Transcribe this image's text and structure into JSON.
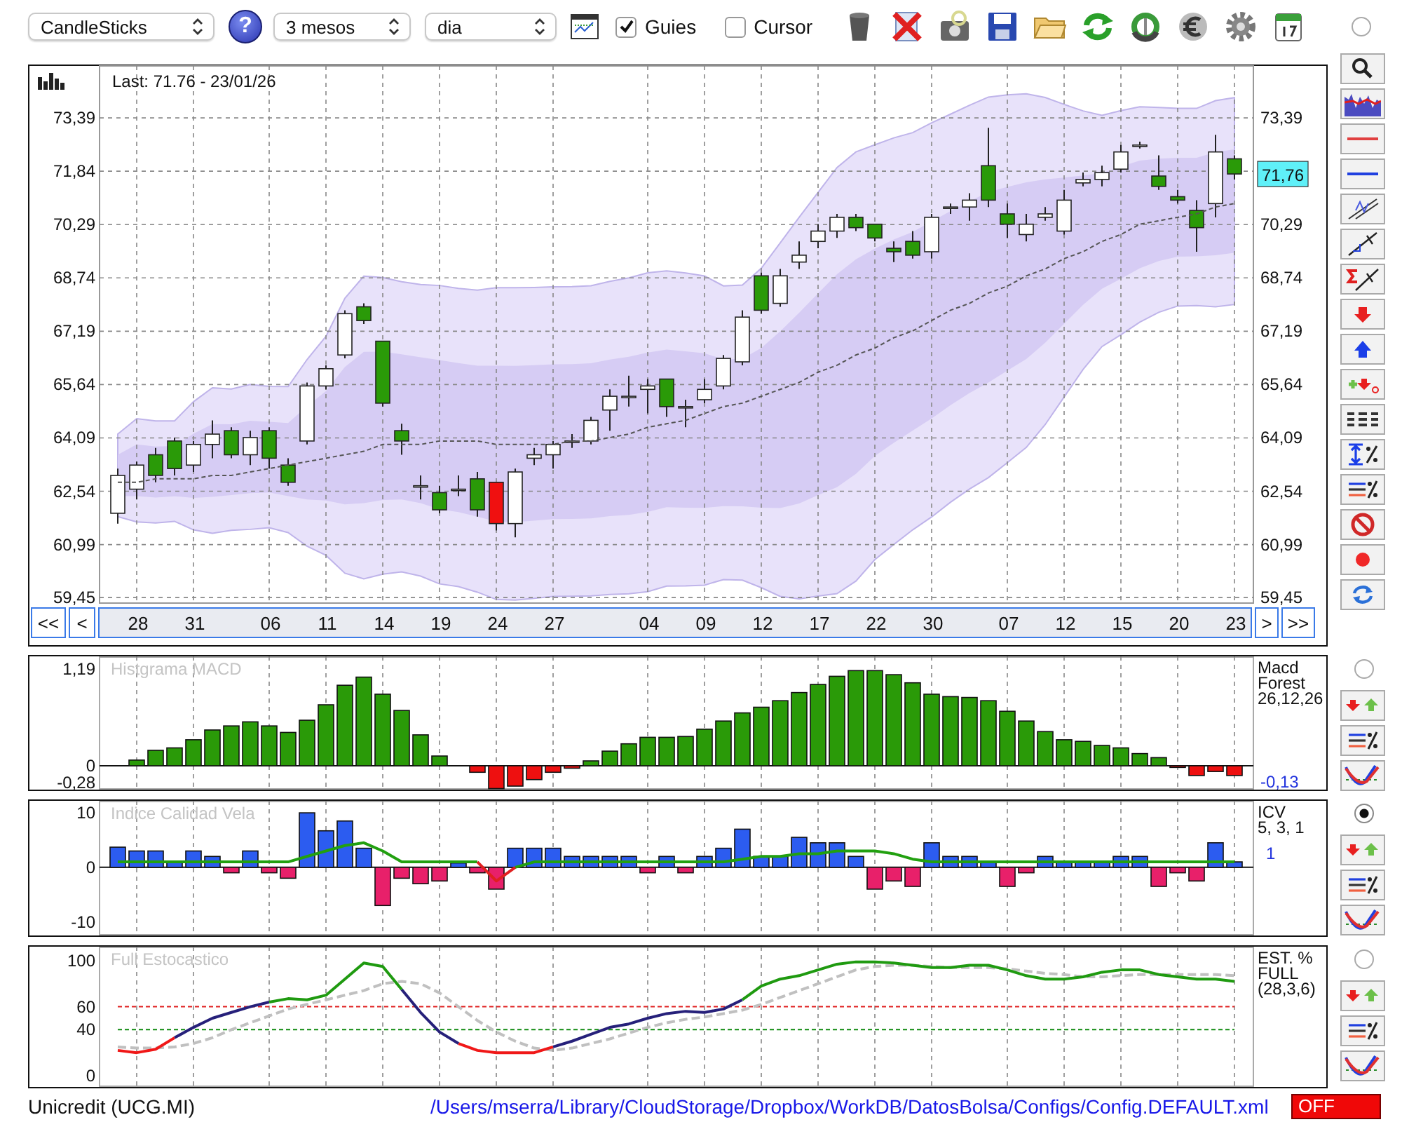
{
  "toolbar": {
    "chart_type": "CandleSticks",
    "help_label": "?",
    "period": "3 mesos",
    "interval": "dia",
    "checkboxes": [
      {
        "label": "Guies",
        "checked": true
      },
      {
        "label": "Cursor",
        "checked": false
      }
    ]
  },
  "price_panel": {
    "selected": false,
    "last": "Last: 71.76 - 23/01/26",
    "current_price": "71,76",
    "nav": {
      "first": "<<",
      "prev": "<",
      "next": ">",
      "last": ">>"
    },
    "right_axis_labels": [
      "73,39",
      "70,29",
      "68,74",
      "67,19",
      "65,64",
      "64,09",
      "62,54",
      "60,99",
      "59,45"
    ],
    "chart_data": {
      "type": "candlestick",
      "grid": true,
      "ylim": [
        59.29,
        74.9
      ],
      "yticks": [
        {
          "value": 73.39,
          "label": "73,39"
        },
        {
          "value": 71.84,
          "label": "71,84"
        },
        {
          "value": 70.29,
          "label": "70,29"
        },
        {
          "value": 68.74,
          "label": "68,74"
        },
        {
          "value": 67.19,
          "label": "67,19"
        },
        {
          "value": 65.64,
          "label": "65,64"
        },
        {
          "value": 64.09,
          "label": "64,09"
        },
        {
          "value": 62.54,
          "label": "62,54"
        },
        {
          "value": 60.99,
          "label": "60,99"
        },
        {
          "value": 59.45,
          "label": "59,45"
        }
      ],
      "categories": [
        null,
        "28",
        null,
        null,
        "31",
        null,
        null,
        null,
        "06",
        null,
        null,
        "11",
        null,
        null,
        "14",
        null,
        null,
        "19",
        null,
        null,
        "24",
        null,
        null,
        "27",
        null,
        null,
        null,
        null,
        "04",
        null,
        null,
        "09",
        null,
        null,
        "12",
        null,
        null,
        "17",
        null,
        null,
        "22",
        null,
        null,
        "30",
        null,
        null,
        null,
        "07",
        null,
        null,
        "12",
        null,
        null,
        "15",
        null,
        null,
        "20",
        null,
        null,
        "23"
      ],
      "ohlc": [
        [
          61.9,
          63.2,
          61.6,
          63.0
        ],
        [
          62.6,
          63.4,
          62.3,
          63.3
        ],
        [
          63.6,
          63.8,
          62.8,
          63.0
        ],
        [
          64.0,
          64.1,
          63.0,
          63.2
        ],
        [
          63.3,
          64.0,
          63.1,
          63.9
        ],
        [
          63.9,
          64.6,
          63.5,
          64.2
        ],
        [
          64.3,
          64.4,
          63.5,
          63.6
        ],
        [
          63.6,
          64.3,
          63.3,
          64.1
        ],
        [
          64.3,
          64.4,
          63.2,
          63.5
        ],
        [
          63.3,
          63.5,
          62.7,
          62.8
        ],
        [
          64.0,
          65.7,
          63.9,
          65.6
        ],
        [
          65.6,
          66.2,
          65.5,
          66.1
        ],
        [
          66.5,
          67.8,
          66.4,
          67.7
        ],
        [
          67.9,
          68.0,
          67.4,
          67.5
        ],
        [
          66.9,
          66.9,
          65.0,
          65.1
        ],
        [
          64.3,
          64.5,
          63.6,
          64.0
        ],
        [
          62.7,
          63.0,
          62.3,
          62.7
        ],
        [
          62.5,
          62.7,
          61.9,
          62.0
        ],
        [
          62.6,
          63.0,
          62.4,
          62.6
        ],
        [
          62.9,
          63.1,
          61.8,
          62.0
        ],
        [
          62.8,
          62.8,
          61.4,
          61.6
        ],
        [
          61.6,
          63.2,
          61.2,
          63.1
        ],
        [
          63.5,
          63.8,
          63.3,
          63.6
        ],
        [
          63.6,
          64.0,
          63.2,
          63.9
        ],
        [
          64.0,
          64.2,
          63.8,
          64.0
        ],
        [
          64.0,
          64.7,
          63.9,
          64.6
        ],
        [
          64.9,
          65.5,
          64.3,
          65.3
        ],
        [
          65.3,
          65.9,
          65.0,
          65.3
        ],
        [
          65.5,
          65.8,
          64.8,
          65.6
        ],
        [
          65.8,
          65.8,
          64.7,
          65.0
        ],
        [
          65.0,
          65.2,
          64.4,
          65.0
        ],
        [
          65.2,
          65.8,
          65.1,
          65.5
        ],
        [
          65.6,
          66.5,
          65.5,
          66.4
        ],
        [
          66.3,
          67.8,
          66.2,
          67.6
        ],
        [
          68.8,
          68.9,
          67.7,
          67.8
        ],
        [
          68.0,
          69.0,
          67.9,
          68.8
        ],
        [
          69.2,
          69.8,
          69.0,
          69.4
        ],
        [
          69.8,
          70.3,
          69.6,
          70.1
        ],
        [
          70.1,
          70.6,
          69.9,
          70.5
        ],
        [
          70.5,
          70.6,
          70.1,
          70.2
        ],
        [
          70.3,
          70.3,
          69.8,
          69.9
        ],
        [
          69.6,
          69.8,
          69.2,
          69.5
        ],
        [
          69.8,
          70.1,
          69.3,
          69.4
        ],
        [
          69.5,
          70.6,
          69.3,
          70.5
        ],
        [
          70.8,
          70.9,
          70.6,
          70.8
        ],
        [
          70.8,
          71.2,
          70.4,
          71.0
        ],
        [
          72.0,
          73.1,
          70.8,
          71.0
        ],
        [
          70.6,
          70.9,
          69.9,
          70.3
        ],
        [
          70.0,
          70.6,
          69.8,
          70.3
        ],
        [
          70.5,
          70.8,
          70.4,
          70.6
        ],
        [
          70.1,
          71.3,
          70.0,
          71.0
        ],
        [
          71.5,
          71.8,
          71.4,
          71.6
        ],
        [
          71.6,
          72.0,
          71.4,
          71.8
        ],
        [
          71.9,
          72.6,
          71.8,
          72.4
        ],
        [
          72.6,
          72.7,
          72.5,
          72.6
        ],
        [
          71.7,
          72.3,
          71.3,
          71.4
        ],
        [
          71.1,
          71.3,
          70.9,
          71.0
        ],
        [
          70.7,
          71.0,
          69.5,
          70.2
        ],
        [
          70.9,
          72.9,
          70.5,
          72.4
        ],
        [
          72.2,
          72.3,
          71.6,
          71.76
        ]
      ],
      "colors": [
        "#ffffff",
        "#ffffff",
        "#2a9a08",
        "#2a9a08",
        "#ffffff",
        "#ffffff",
        "#2a9a08",
        "#ffffff",
        "#2a9a08",
        "#2a9a08",
        "#ffffff",
        "#ffffff",
        "#ffffff",
        "#2a9a08",
        "#2a9a08",
        "#2a9a08",
        "#ffffff",
        "#2a9a08",
        "#ffffff",
        "#2a9a08",
        "#f01010",
        "#ffffff",
        "#ffffff",
        "#ffffff",
        "#ffffff",
        "#ffffff",
        "#ffffff",
        "#ffffff",
        "#ffffff",
        "#2a9a08",
        "#ffffff",
        "#ffffff",
        "#ffffff",
        "#ffffff",
        "#2a9a08",
        "#ffffff",
        "#ffffff",
        "#ffffff",
        "#ffffff",
        "#2a9a08",
        "#2a9a08",
        "#2a9a08",
        "#2a9a08",
        "#ffffff",
        "#ffffff",
        "#ffffff",
        "#2a9a08",
        "#2a9a08",
        "#ffffff",
        "#ffffff",
        "#ffffff",
        "#ffffff",
        "#ffffff",
        "#ffffff",
        "#ffffff",
        "#2a9a08",
        "#2a9a08",
        "#2a9a08",
        "#ffffff",
        "#2a9a08"
      ],
      "series": [
        {
          "type": "line",
          "color": "#555555",
          "line_style": "dashed",
          "values": [
            62.8,
            62.8,
            62.9,
            62.9,
            62.9,
            63.0,
            63.0,
            63.1,
            63.2,
            63.3,
            63.4,
            63.5,
            63.6,
            63.7,
            63.9,
            63.9,
            63.9,
            64.0,
            64.0,
            64.0,
            63.9,
            63.9,
            63.9,
            63.9,
            64.0,
            64.0,
            64.1,
            64.2,
            64.4,
            64.5,
            64.6,
            64.8,
            65.0,
            65.1,
            65.3,
            65.5,
            65.7,
            66.0,
            66.2,
            66.5,
            66.7,
            67.0,
            67.2,
            67.5,
            67.8,
            68.0,
            68.3,
            68.5,
            68.8,
            69.0,
            69.3,
            69.5,
            69.8,
            70.0,
            70.3,
            70.4,
            70.5,
            70.6,
            70.8,
            70.9
          ]
        }
      ]
    }
  },
  "macd_panel": {
    "selected": false,
    "labels": [
      "Macd",
      "Forest",
      "26,12,26"
    ],
    "reading": "-0,13",
    "chart_data": {
      "type": "bar",
      "title": "Histgrama MACD",
      "grid": true,
      "ylim": [
        -0.293,
        1.345
      ],
      "yticks": [
        {
          "value": 1.19,
          "label": "1,19"
        },
        {
          "value": 0,
          "label": "0"
        },
        {
          "value": -0.28,
          "label": "-0,28"
        }
      ],
      "values": [
        null,
        0.07,
        0.19,
        0.22,
        0.32,
        0.44,
        0.49,
        0.54,
        0.49,
        0.41,
        0.56,
        0.75,
        0.99,
        1.09,
        0.88,
        0.68,
        0.38,
        0.12,
        null,
        -0.08,
        -0.28,
        -0.25,
        -0.17,
        -0.08,
        -0.03,
        0.06,
        0.18,
        0.27,
        0.35,
        0.35,
        0.36,
        0.45,
        0.55,
        0.65,
        0.72,
        0.8,
        0.9,
        1.0,
        1.1,
        1.17,
        1.17,
        1.12,
        1.02,
        0.88,
        0.85,
        0.84,
        0.8,
        0.67,
        0.55,
        0.42,
        0.32,
        0.3,
        0.25,
        0.22,
        0.15,
        0.1,
        -0.02,
        -0.12,
        -0.07,
        -0.12
      ]
    }
  },
  "icv_panel": {
    "selected": true,
    "labels": [
      "ICV",
      "5, 3, 1"
    ],
    "reading": "1",
    "chart_data": {
      "type": "bar",
      "title": "Indice Calidad Vela",
      "grid": true,
      "ylim": [
        -12.5,
        12.2
      ],
      "yticks": [
        {
          "value": 10,
          "label": "10"
        },
        {
          "value": 0,
          "label": "0"
        },
        {
          "value": -10,
          "label": "-10"
        }
      ],
      "series": [
        {
          "type": "bar",
          "values": [
            3.7,
            3,
            3,
            1,
            3,
            2,
            -1,
            3,
            -1,
            -2,
            10,
            6.7,
            8.5,
            3.5,
            -7,
            -2,
            -3,
            -2.5,
            0.8,
            -1,
            -4,
            3.5,
            3.5,
            3.5,
            2,
            2,
            2,
            2,
            -1,
            2,
            -1,
            2,
            3.5,
            7,
            2,
            2,
            5.5,
            4.5,
            4.5,
            2,
            -4,
            -2.5,
            -3.5,
            4.5,
            2,
            2,
            1,
            -3.5,
            -1,
            2,
            1,
            1,
            1,
            2,
            2,
            -3.5,
            -1,
            -2.5,
            4.5,
            1
          ],
          "colors": [
            "#2c5cf0",
            "#2c5cf0",
            "#2c5cf0",
            "#2c5cf0",
            "#2c5cf0",
            "#2c5cf0",
            "#e8206a",
            "#2c5cf0",
            "#e8206a",
            "#e8206a",
            "#2c5cf0",
            "#2c5cf0",
            "#2c5cf0",
            "#2c5cf0",
            "#e8206a",
            "#e8206a",
            "#e8206a",
            "#e8206a",
            "#2c5cf0",
            "#e8206a",
            "#e8206a",
            "#2c5cf0",
            "#2c5cf0",
            "#2c5cf0",
            "#2c5cf0",
            "#2c5cf0",
            "#2c5cf0",
            "#2c5cf0",
            "#e8206a",
            "#2c5cf0",
            "#e8206a",
            "#2c5cf0",
            "#2c5cf0",
            "#2c5cf0",
            "#2c5cf0",
            "#2c5cf0",
            "#2c5cf0",
            "#2c5cf0",
            "#2c5cf0",
            "#2c5cf0",
            "#e8206a",
            "#e8206a",
            "#e8206a",
            "#2c5cf0",
            "#2c5cf0",
            "#2c5cf0",
            "#2c5cf0",
            "#e8206a",
            "#e8206a",
            "#2c5cf0",
            "#2c5cf0",
            "#2c5cf0",
            "#2c5cf0",
            "#2c5cf0",
            "#2c5cf0",
            "#e8206a",
            "#e8206a",
            "#e8206a",
            "#2c5cf0",
            "#2c5cf0"
          ]
        },
        {
          "type": "line",
          "color": "#22a010",
          "values": [
            1,
            1,
            1,
            1,
            1,
            1,
            1,
            1,
            1,
            1,
            2,
            3,
            4,
            4.5,
            3,
            1,
            1,
            1,
            1,
            1,
            null,
            0,
            1,
            1,
            1,
            1,
            1,
            1,
            1,
            1,
            1,
            1,
            1,
            1.5,
            2,
            2,
            2.5,
            2.5,
            3,
            3,
            3,
            2.5,
            1.5,
            1,
            1,
            1,
            1,
            1,
            1,
            1,
            1,
            1,
            1,
            1,
            1,
            1,
            1,
            1,
            1,
            1
          ]
        },
        {
          "type": "line",
          "color": "#e02020",
          "values": [
            null,
            null,
            null,
            null,
            null,
            null,
            null,
            null,
            null,
            null,
            null,
            null,
            null,
            null,
            null,
            null,
            null,
            null,
            null,
            1,
            -2.5,
            0,
            null,
            null,
            null,
            null,
            null,
            null,
            null,
            null,
            null,
            null,
            null,
            null,
            null,
            null,
            null,
            null,
            null,
            null,
            null,
            null,
            null,
            null,
            null,
            null,
            null,
            null,
            null,
            null,
            null,
            null,
            null,
            null,
            null,
            null,
            null,
            null,
            null,
            null
          ]
        }
      ]
    }
  },
  "stoch_panel": {
    "selected": false,
    "labels": [
      "EST. %",
      "FULL",
      "(28,3,6)"
    ],
    "chart_data": {
      "type": "line",
      "title": "Full Estocastico",
      "grid": true,
      "ylim": [
        -9.8,
        112.2
      ],
      "yticks": [
        {
          "value": 100,
          "label": "100"
        },
        {
          "value": 60,
          "label": "60"
        },
        {
          "value": 40,
          "label": "40"
        },
        {
          "value": 0,
          "label": "0"
        }
      ],
      "series": [
        {
          "color": "#e02020",
          "line_style": "dotted",
          "values": [
            60,
            60,
            60,
            60,
            60,
            60,
            60,
            60,
            60,
            60,
            60,
            60,
            60,
            60,
            60,
            60,
            60,
            60,
            60,
            60,
            60,
            60,
            60,
            60,
            60,
            60,
            60,
            60,
            60,
            60,
            60,
            60,
            60,
            60,
            60,
            60,
            60,
            60,
            60,
            60,
            60,
            60,
            60,
            60,
            60,
            60,
            60,
            60,
            60,
            60,
            60,
            60,
            60,
            60,
            60,
            60,
            60,
            60,
            60,
            60
          ]
        },
        {
          "color": "#108a10",
          "line_style": "dotted",
          "values": [
            40,
            40,
            40,
            40,
            40,
            40,
            40,
            40,
            40,
            40,
            40,
            40,
            40,
            40,
            40,
            40,
            40,
            40,
            40,
            40,
            40,
            40,
            40,
            40,
            40,
            40,
            40,
            40,
            40,
            40,
            40,
            40,
            40,
            40,
            40,
            40,
            40,
            40,
            40,
            40,
            40,
            40,
            40,
            40,
            40,
            40,
            40,
            40,
            40,
            40,
            40,
            40,
            40,
            40,
            40,
            40,
            40,
            40,
            40,
            40
          ]
        },
        {
          "color": "#c0c0c0",
          "line_style": "dashed",
          "values": [
            25,
            24,
            24,
            25,
            28,
            33,
            40,
            46,
            52,
            58,
            62,
            66,
            70,
            74,
            80,
            82,
            80,
            72,
            60,
            48,
            38,
            30,
            24,
            22,
            24,
            28,
            32,
            37,
            42,
            46,
            49,
            51,
            54,
            57,
            62,
            68,
            74,
            80,
            86,
            92,
            95,
            96,
            96,
            95,
            94,
            94,
            94,
            93,
            91,
            89,
            88,
            86,
            86,
            87,
            88,
            88,
            88,
            88,
            88,
            87
          ]
        },
        {
          "color": "#f01818",
          "values": [
            22,
            20,
            23,
            33,
            null,
            null,
            null,
            null,
            null,
            null,
            null,
            null,
            null,
            null,
            null,
            null,
            null,
            null,
            28,
            22,
            20,
            20,
            20,
            25,
            null,
            null,
            null,
            null,
            null,
            null,
            null,
            null,
            null,
            null,
            null,
            null,
            null,
            null,
            null,
            null,
            null,
            null,
            null,
            null,
            null,
            null,
            null,
            null,
            null,
            null,
            null,
            null,
            null,
            null,
            null,
            null,
            null,
            null,
            null,
            null
          ]
        },
        {
          "color": "#26207a",
          "values": [
            null,
            null,
            null,
            33,
            42,
            50,
            55,
            60,
            64,
            null,
            null,
            null,
            null,
            null,
            null,
            75,
            55,
            38,
            28,
            null,
            null,
            null,
            null,
            25,
            30,
            36,
            42,
            45,
            50,
            54,
            56,
            55,
            58,
            66,
            null,
            null,
            null,
            null,
            null,
            null,
            null,
            null,
            null,
            null,
            null,
            null,
            null,
            null,
            null,
            null,
            null,
            null,
            null,
            null,
            null,
            null,
            null,
            null,
            null,
            null
          ]
        },
        {
          "color": "#1f9a10",
          "values": [
            null,
            null,
            null,
            null,
            null,
            null,
            null,
            null,
            64,
            67,
            66,
            70,
            84,
            98,
            95,
            75,
            null,
            null,
            null,
            null,
            null,
            null,
            null,
            null,
            null,
            null,
            null,
            null,
            null,
            null,
            null,
            null,
            null,
            66,
            78,
            84,
            87,
            92,
            97,
            99,
            99,
            98,
            96,
            94,
            94,
            96,
            96,
            92,
            87,
            84,
            84,
            86,
            90,
            92,
            92,
            88,
            86,
            84,
            84,
            82
          ]
        }
      ]
    }
  },
  "status_bar": {
    "instrument": "Unicredit (UCG.MI)",
    "path": "/Users/mserra/Library/CloudStorage/Dropbox/WorkDB/DatosBolsa/Configs/Config.DEFAULT.xml",
    "state": "OFF"
  }
}
